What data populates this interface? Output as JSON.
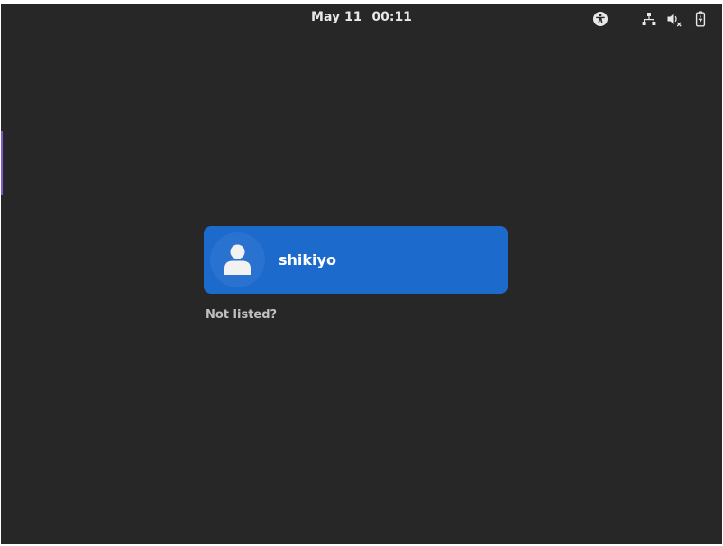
{
  "top_bar": {
    "date": "May 11",
    "time": "00:11",
    "tray_icons": [
      "accessibility-icon",
      "network-wired-icon",
      "volume-muted-icon",
      "battery-charging-icon"
    ]
  },
  "login": {
    "users": [
      {
        "name": "shikiyo",
        "avatar_icon": "user-avatar-icon"
      }
    ],
    "not_listed_label": "Not listed?"
  },
  "colors": {
    "background": "#272727",
    "card": "#1c6acc",
    "accent_edge": "#7a5dc7"
  }
}
